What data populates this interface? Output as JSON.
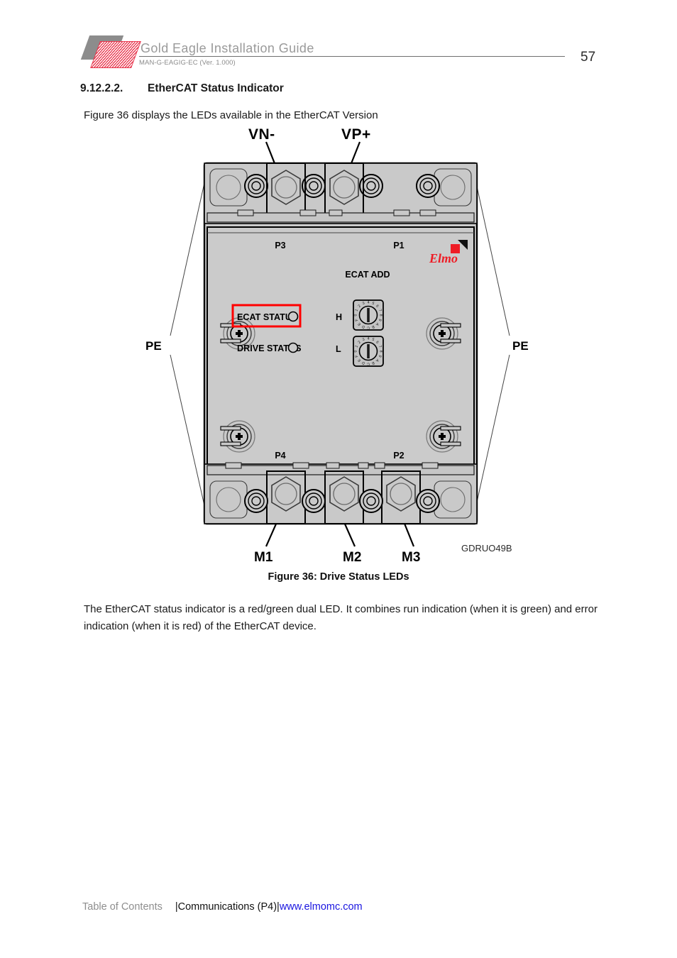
{
  "header": {
    "logo_name": "elmo-logo",
    "title": "Gold Eagle Installation Guide",
    "subtitle": "MAN-G-EAGIG-EC (Ver. 1.000)",
    "page_number": "57"
  },
  "content": {
    "section_number": "9.12.2.2.",
    "section_title": "EtherCAT Status Indicator",
    "intro_paragraph": "Figure 36 displays the LEDs available in the EtherCAT Version",
    "body_paragraph": "The EtherCAT status indicator is a red/green dual LED. It combines run indication (when it is green) and error indication (when it is red) of the EtherCAT device.",
    "figure_caption": "Figure 36: Drive Status LEDs"
  },
  "figure": {
    "drawing_code": "GDRUO49B",
    "brand_logo_text": "Elmo",
    "callouts": {
      "vn_minus": "VN-",
      "vp_plus": "VP+",
      "pe_left": "PE",
      "pe_right": "PE",
      "m1": "M1",
      "m2": "M2",
      "m3": "M3"
    },
    "board_labels": {
      "p3": "P3",
      "p1": "P1",
      "p4": "P4",
      "p2": "P2",
      "ecat_add": "ECAT ADD",
      "ecat_status": "ECAT STATUS",
      "drive_status": "DRIVE STATUS",
      "switch_high": "H",
      "switch_low": "L"
    },
    "rotary_switch_digits": "0123456789ABCDEF",
    "highlight_color": "#ff0000",
    "board_color": "#cccccc",
    "brand_color": "#ee1c25"
  },
  "footer": {
    "table_of_contents": "Table of Contents",
    "breadcrumb": "|Communications (P4)|",
    "website": "www.elmomc.com"
  }
}
